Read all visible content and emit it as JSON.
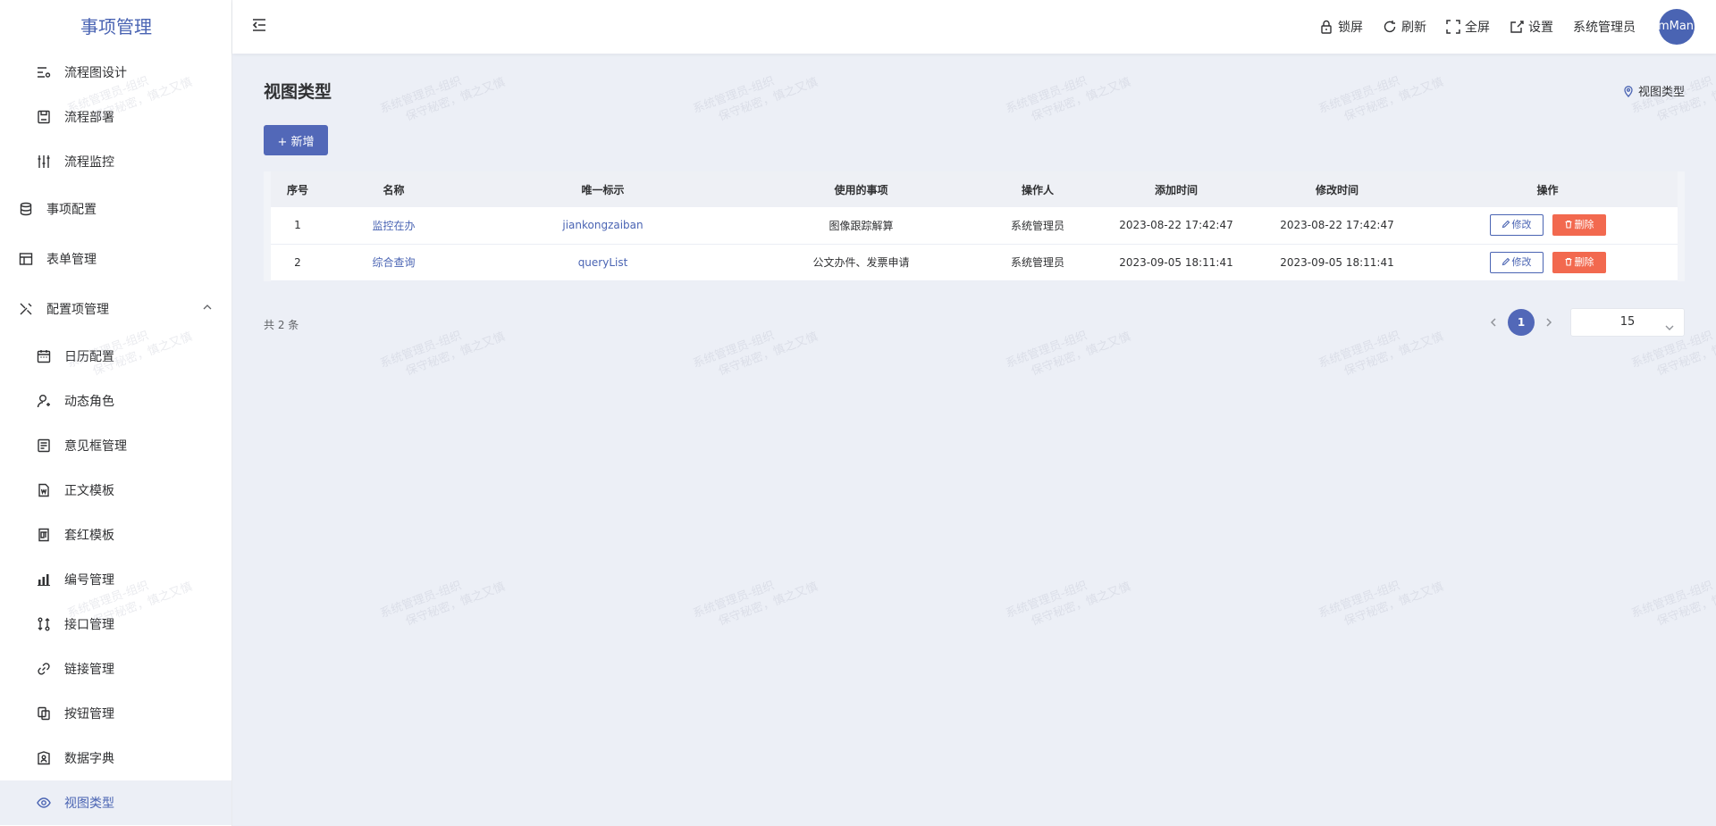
{
  "app": {
    "title": "事项管理"
  },
  "sidebar": {
    "items": [
      {
        "label": "流程图设计",
        "icon": "flow-design-icon",
        "level": "sub"
      },
      {
        "label": "流程部署",
        "icon": "deploy-icon",
        "level": "sub"
      },
      {
        "label": "流程监控",
        "icon": "monitor-icon",
        "level": "sub"
      },
      {
        "label": "事项配置",
        "icon": "database-icon",
        "level": "top"
      },
      {
        "label": "表单管理",
        "icon": "table-icon",
        "level": "top"
      },
      {
        "label": "配置项管理",
        "icon": "tools-icon",
        "level": "top"
      },
      {
        "label": "日历配置",
        "icon": "calendar-icon",
        "level": "sub"
      },
      {
        "label": "动态角色",
        "icon": "user-add-icon",
        "level": "sub"
      },
      {
        "label": "意见框管理",
        "icon": "comment-box-icon",
        "level": "sub"
      },
      {
        "label": "正文模板",
        "icon": "doc-template-icon",
        "level": "sub"
      },
      {
        "label": "套红模板",
        "icon": "red-template-icon",
        "level": "sub"
      },
      {
        "label": "编号管理",
        "icon": "bar-chart-icon",
        "level": "sub"
      },
      {
        "label": "接口管理",
        "icon": "interface-icon",
        "level": "sub"
      },
      {
        "label": "链接管理",
        "icon": "link-icon",
        "level": "sub"
      },
      {
        "label": "按钮管理",
        "icon": "button-copy-icon",
        "level": "sub"
      },
      {
        "label": "数据字典",
        "icon": "dictionary-icon",
        "level": "sub"
      },
      {
        "label": "视图类型",
        "icon": "eye-icon",
        "level": "sub",
        "active": true
      }
    ]
  },
  "header": {
    "lock": "锁屏",
    "refresh": "刷新",
    "fullscreen": "全屏",
    "settings": "设置",
    "username": "系统管理员",
    "avatar_text": "emMan"
  },
  "main": {
    "title": "视图类型",
    "breadcrumb": "视图类型",
    "add_button": "+ 新增",
    "table": {
      "columns": [
        "序号",
        "名称",
        "唯一标示",
        "使用的事项",
        "操作人",
        "添加时间",
        "修改时间",
        "操作"
      ],
      "rows": [
        {
          "index": "1",
          "name": "监控在办",
          "key": "jiankongzaiban",
          "usage": "图像跟踪解算",
          "operator": "系统管理员",
          "created": "2023-08-22 17:42:47",
          "modified": "2023-08-22 17:42:47"
        },
        {
          "index": "2",
          "name": "综合查询",
          "key": "queryList",
          "usage": "公文办件、发票申请",
          "operator": "系统管理员",
          "created": "2023-09-05 18:11:41",
          "modified": "2023-09-05 18:11:41"
        }
      ],
      "edit_label": "修改",
      "delete_label": "删除"
    },
    "total": "共 2 条",
    "pagination": {
      "current": "1",
      "page_size": "15"
    }
  },
  "watermark": {
    "line1": "系统管理员-组织",
    "line2": "保守秘密，慎之又慎"
  },
  "colors": {
    "primary": "#4a64b3",
    "danger": "#f2694f",
    "background": "#eceff6"
  }
}
